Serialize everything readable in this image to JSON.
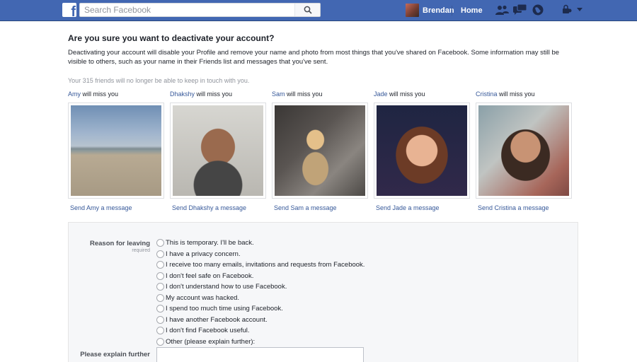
{
  "header": {
    "search_placeholder": "Search Facebook",
    "profile_name": "Brendan",
    "home_label": "Home"
  },
  "main": {
    "heading": "Are you sure you want to deactivate your account?",
    "description": "Deactivating your account will disable your Profile and remove your name and photo from most things that you've shared on Facebook. Some information may still be visible to others, such as your name in their Friends list and messages that you've sent.",
    "friends_note": "Your 315 friends will no longer be able to keep in touch with you.",
    "miss_suffix": " will miss you",
    "friends": [
      {
        "name": "Amy",
        "send": "Send Amy a message"
      },
      {
        "name": "Dhakshy",
        "send": "Send Dhakshy a message"
      },
      {
        "name": "Sam",
        "send": "Send Sam a message"
      },
      {
        "name": "Jade",
        "send": "Send Jade a message"
      },
      {
        "name": "Cristina",
        "send": "Send Cristina a message"
      }
    ]
  },
  "form": {
    "reason_label": "Reason for leaving",
    "required_label": "required",
    "reasons": [
      "This is temporary. I'll be back.",
      "I have a privacy concern.",
      "I receive too many emails, invitations and requests from Facebook.",
      "I don't feel safe on Facebook.",
      "I don't understand how to use Facebook.",
      "My account was hacked.",
      "I spend too much time using Facebook.",
      "I have another Facebook account.",
      "I don't find Facebook useful.",
      "Other (please explain further):"
    ],
    "explain_label": "Please explain further"
  },
  "colors": {
    "topbar": "#4267b2",
    "link": "#365899"
  }
}
